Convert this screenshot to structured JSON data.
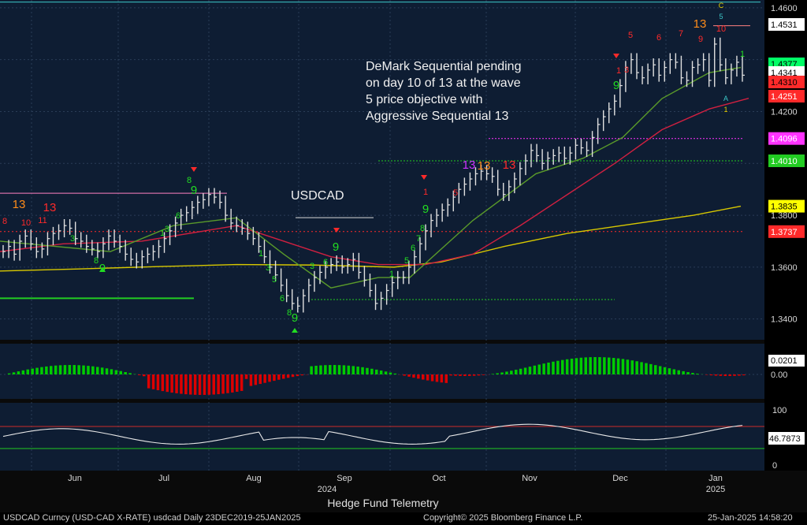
{
  "chart_data": {
    "type": "candlestick",
    "title": "USDCAD",
    "annotation": "DeMark Sequential pending\non day 10 of 13 at the wave\n5 price objective with\nAggressive Sequential 13",
    "x_months": [
      "Jun",
      "Jul",
      "Aug",
      "Sep",
      "Oct",
      "Nov",
      "Dec",
      "Jan"
    ],
    "year_labels": [
      "2024",
      "2025"
    ],
    "xlabel": "Hedge Fund Telemetry",
    "price_ticks": [
      "1.4600",
      "1.4200",
      "1.3800",
      "1.3600",
      "1.3400"
    ],
    "ylim": [
      1.332,
      1.463
    ],
    "price_tags": [
      {
        "value": 1.4531,
        "label": "1.4531",
        "bg": "#ffffff",
        "fg": "#000000"
      },
      {
        "value": 1.4377,
        "label": "1.4377",
        "bg": "#00ff66",
        "fg": "#000000"
      },
      {
        "value": 1.4341,
        "label": "1.4341",
        "bg": "#ffffff",
        "fg": "#000000"
      },
      {
        "value": 1.431,
        "label": "1.4310",
        "bg": "#ff2a2a",
        "fg": "#000000"
      },
      {
        "value": 1.4251,
        "label": "1.4251",
        "bg": "#ff2a2a",
        "fg": "#ffffff"
      },
      {
        "value": 1.4096,
        "label": "1.4096",
        "bg": "#ff33ff",
        "fg": "#ffffff"
      },
      {
        "value": 1.401,
        "label": "1.4010",
        "bg": "#22cc22",
        "fg": "#ffffff"
      },
      {
        "value": 1.3835,
        "label": "1.3835",
        "bg": "#ffff00",
        "fg": "#000000"
      },
      {
        "value": 1.3737,
        "label": "1.3737",
        "bg": "#ff2a2a",
        "fg": "#ffffff"
      }
    ],
    "ohlc_close": [
      1.366,
      1.368,
      1.365,
      1.37,
      1.372,
      1.369,
      1.366,
      1.367,
      1.371,
      1.373,
      1.374,
      1.376,
      1.375,
      1.371,
      1.37,
      1.368,
      1.367,
      1.366,
      1.369,
      1.372,
      1.37,
      1.368,
      1.365,
      1.363,
      1.362,
      1.364,
      1.365,
      1.366,
      1.368,
      1.371,
      1.374,
      1.377,
      1.38,
      1.381,
      1.383,
      1.385,
      1.386,
      1.388,
      1.387,
      1.385,
      1.38,
      1.377,
      1.376,
      1.375,
      1.373,
      1.371,
      1.368,
      1.364,
      1.36,
      1.357,
      1.353,
      1.349,
      1.346,
      1.345,
      1.349,
      1.353,
      1.356,
      1.358,
      1.36,
      1.361,
      1.362,
      1.36,
      1.361,
      1.363,
      1.358,
      1.355,
      1.351,
      1.346,
      1.348,
      1.351,
      1.354,
      1.356,
      1.356,
      1.36,
      1.364,
      1.369,
      1.374,
      1.378,
      1.38,
      1.382,
      1.384,
      1.387,
      1.39,
      1.392,
      1.394,
      1.396,
      1.397,
      1.396,
      1.395,
      1.39,
      1.388,
      1.391,
      1.394,
      1.398,
      1.401,
      1.405,
      1.403,
      1.4,
      1.402,
      1.403,
      1.404,
      1.402,
      1.404,
      1.407,
      1.406,
      1.405,
      1.41,
      1.415,
      1.418,
      1.421,
      1.424,
      1.43,
      1.437,
      1.44,
      1.435,
      1.433,
      1.436,
      1.438,
      1.434,
      1.437,
      1.44,
      1.439,
      1.433,
      1.432,
      1.437,
      1.438,
      1.44,
      1.432,
      1.446,
      1.438,
      1.433,
      1.436,
      1.439,
      1.434
    ],
    "ma_yellow_end": 1.3835,
    "ma_red_end": 1.4251,
    "macd_label": "0.0201",
    "macd_ticks": [
      "0.00"
    ],
    "rsi_label": "46.7873",
    "rsi_ticks": [
      "100",
      "50",
      "0"
    ],
    "rsi_bounds": [
      70,
      30
    ],
    "legend_colors": {
      "up": "#00e000",
      "down": "#e00000",
      "price": "#e0e0e0",
      "ma_yellow": "#d8c800",
      "ma_red": "#d02040",
      "ma_green": "#5a9a2a"
    }
  },
  "footer": {
    "ticker": "USDCAD Curncy (USD-CAD X-RATE) usdcad  Daily 23DEC2019-25JAN2025",
    "copyright": "Copyright© 2025 Bloomberg Finance L.P.",
    "timestamp": "25-Jan-2025 14:58:20"
  }
}
